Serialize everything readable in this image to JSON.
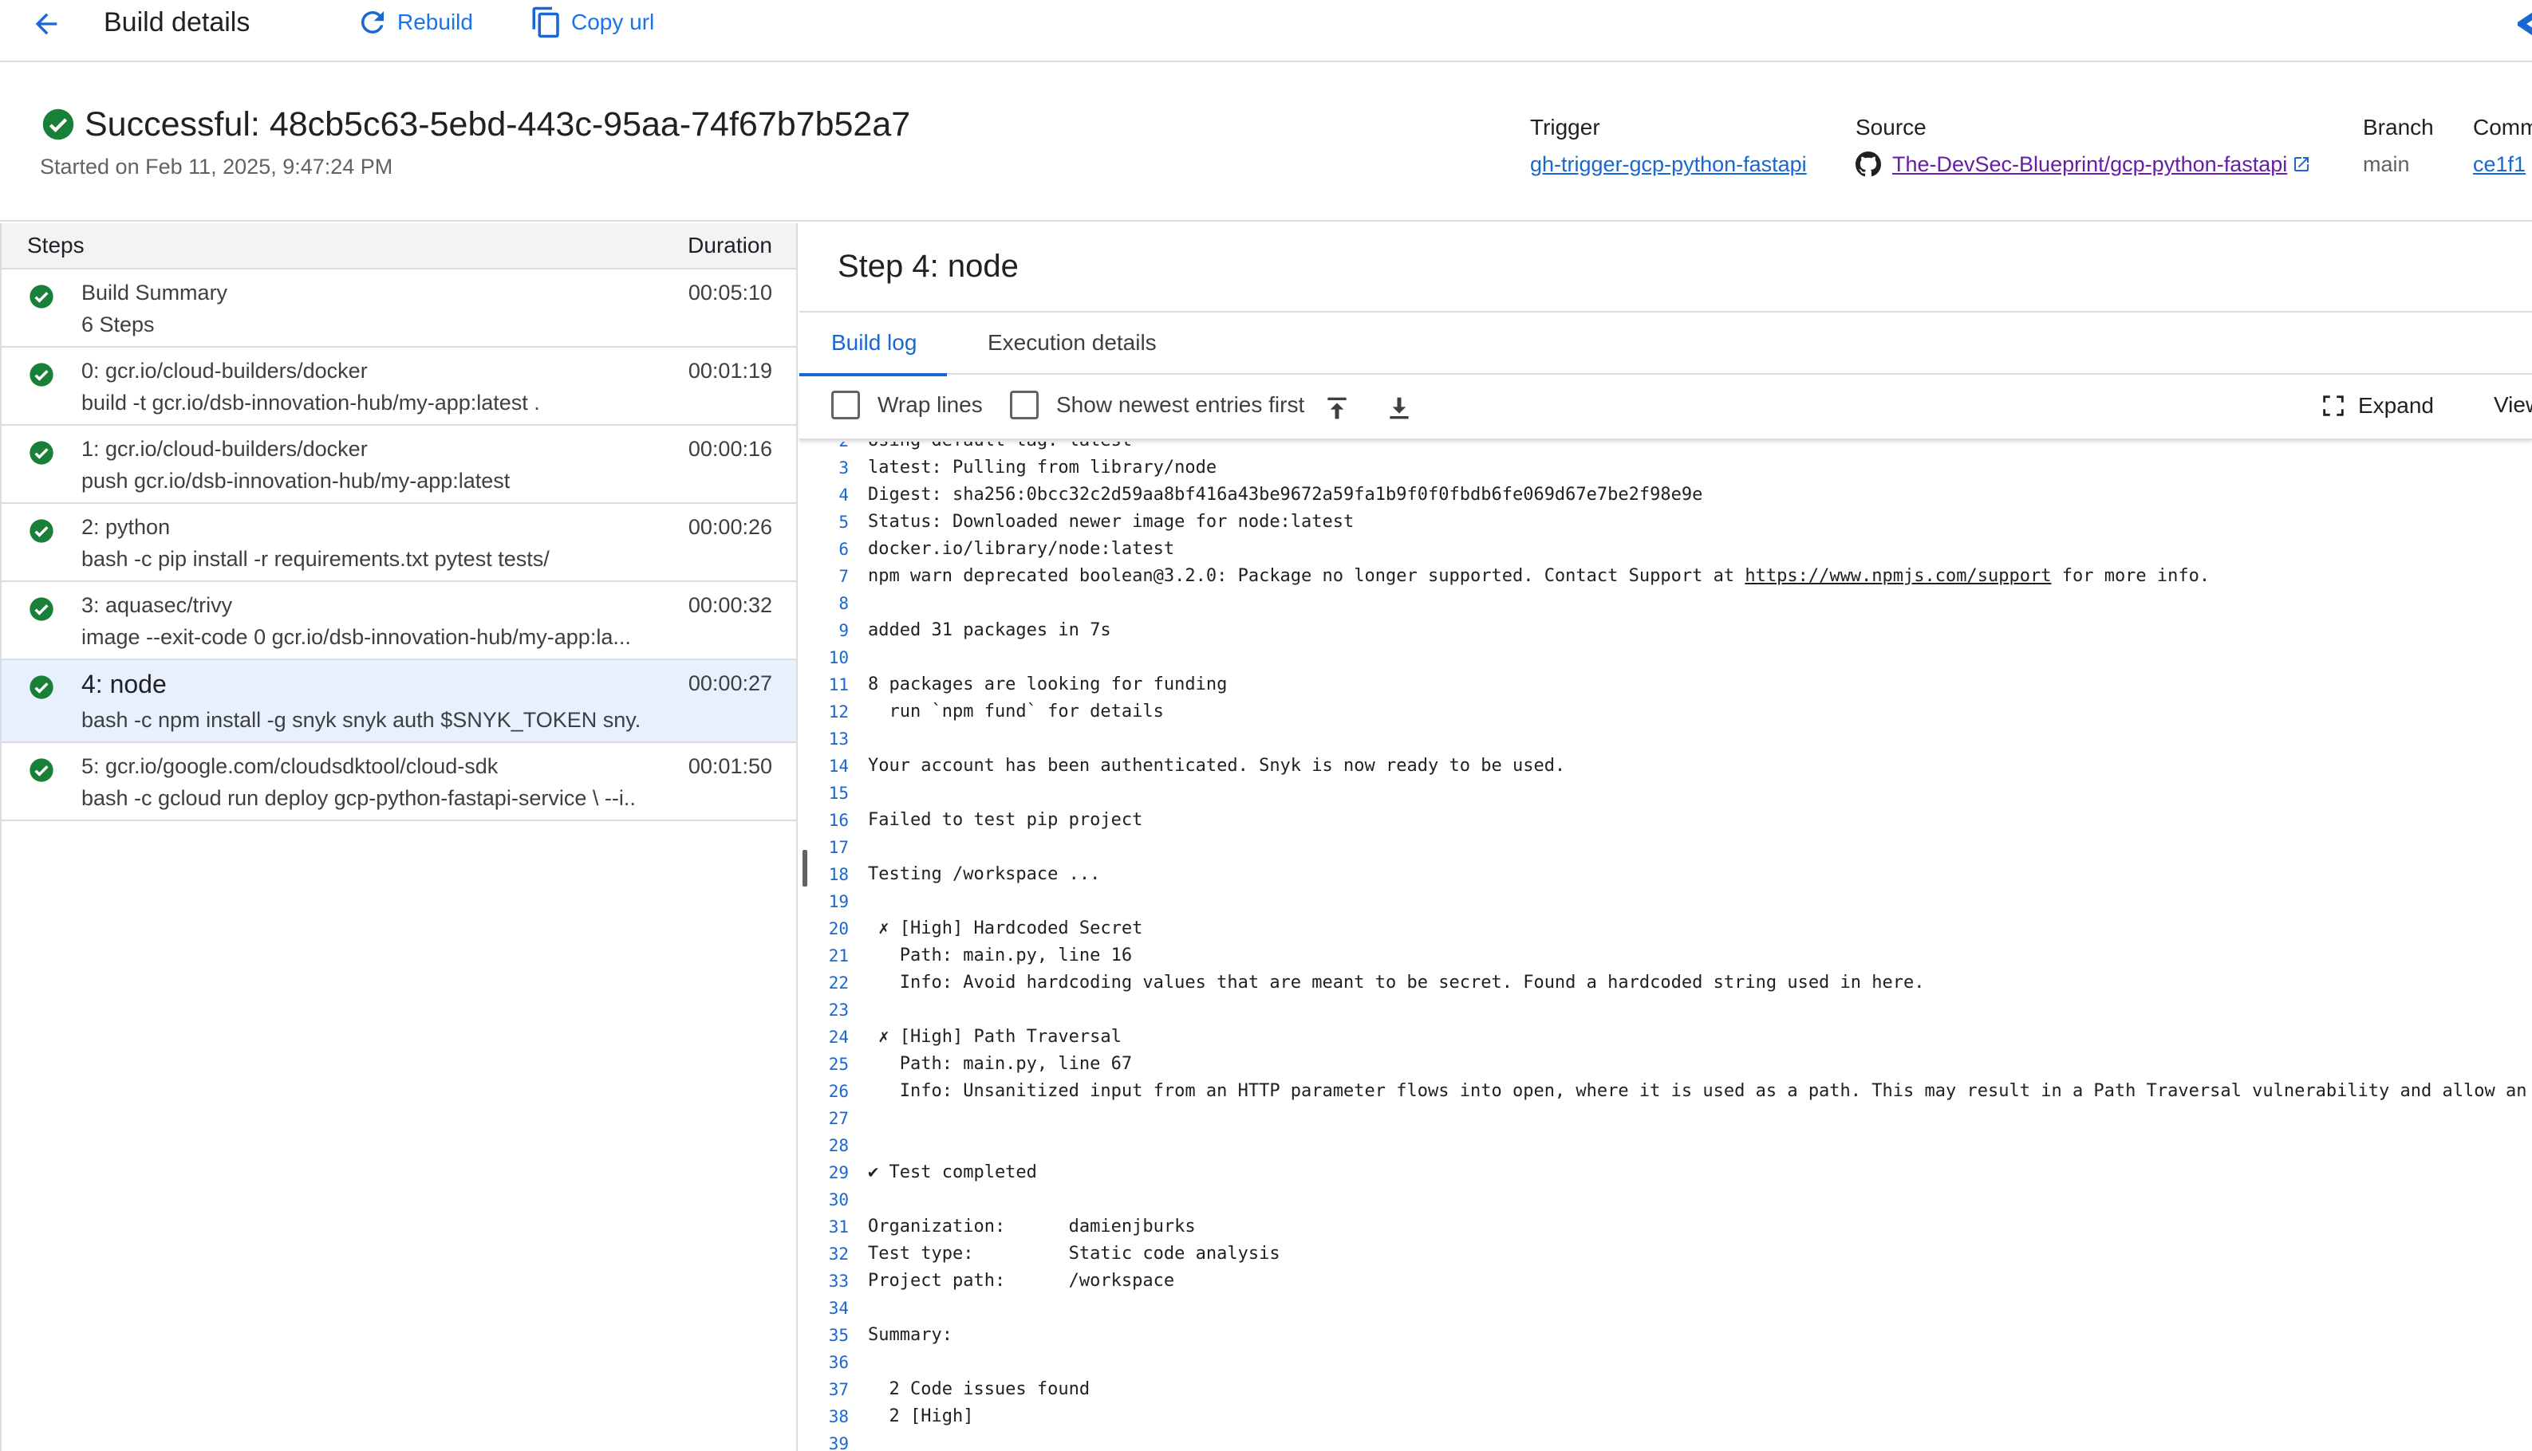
{
  "appbar": {
    "title": "Build details",
    "rebuild_label": "Rebuild",
    "copy_label": "Copy url"
  },
  "build": {
    "status_prefix": "Successful:",
    "id": "48cb5c63-5ebd-443c-95aa-74f67b7b52a7",
    "title": "Successful: 48cb5c63-5ebd-443c-95aa-74f67b7b52a7",
    "started": "Started on Feb 11, 2025, 9:47:24 PM",
    "trigger_label": "Trigger",
    "trigger_value": "gh-trigger-gcp-python-fastapi",
    "source_label": "Source",
    "source_value": "The-DevSec-Blueprint/gcp-python-fastapi",
    "branch_label": "Branch",
    "branch_value": "main",
    "commit_label": "Comm",
    "commit_value": "ce1f1",
    "status_color": "#188038"
  },
  "steps": {
    "header_steps": "Steps",
    "header_duration": "Duration",
    "items": [
      {
        "title": "Build Summary",
        "sub": "6 Steps",
        "duration": "00:05:10"
      },
      {
        "title": "0: gcr.io/cloud-builders/docker",
        "sub": "build -t gcr.io/dsb-innovation-hub/my-app:latest .",
        "duration": "00:01:19"
      },
      {
        "title": "1: gcr.io/cloud-builders/docker",
        "sub": "push gcr.io/dsb-innovation-hub/my-app:latest",
        "duration": "00:00:16"
      },
      {
        "title": "2: python",
        "sub": "bash -c pip install -r requirements.txt pytest tests/",
        "duration": "00:00:26"
      },
      {
        "title": "3: aquasec/trivy",
        "sub": "image --exit-code 0 gcr.io/dsb-innovation-hub/my-app:la...",
        "duration": "00:00:32"
      },
      {
        "title": "4: node",
        "sub": "bash -c npm install -g snyk snyk auth $SNYK_TOKEN sny.",
        "duration": "00:00:27"
      },
      {
        "title": "5: gcr.io/google.com/cloudsdktool/cloud-sdk",
        "sub": "bash -c gcloud run deploy gcp-python-fastapi-service \\ --i..",
        "duration": "00:01:50"
      }
    ]
  },
  "log": {
    "step_heading": "Step 4: node",
    "tab_build": "Build log",
    "tab_exec": "Execution details",
    "wrap_label": "Wrap lines",
    "newest_label": "Show newest entries first",
    "expand_label": "Expand",
    "view_label": "View",
    "lines": [
      {
        "n": "2",
        "t": "Using default tag: latest"
      },
      {
        "n": "3",
        "t": "latest: Pulling from library/node"
      },
      {
        "n": "4",
        "t": "Digest: sha256:0bcc32c2d59aa8bf416a43be9672a59fa1b9f0f0fbdb6fe069d67e7be2f98e9e"
      },
      {
        "n": "5",
        "t": "Status: Downloaded newer image for node:latest"
      },
      {
        "n": "6",
        "t": "docker.io/library/node:latest"
      },
      {
        "n": "7",
        "t": "npm warn deprecated boolean@3.2.0: Package no longer supported. Contact Support at ",
        "link": "https://www.npmjs.com/support",
        "after": " for more info."
      },
      {
        "n": "8",
        "t": ""
      },
      {
        "n": "9",
        "t": "added 31 packages in 7s"
      },
      {
        "n": "10",
        "t": ""
      },
      {
        "n": "11",
        "t": "8 packages are looking for funding"
      },
      {
        "n": "12",
        "t": "  run `npm fund` for details"
      },
      {
        "n": "13",
        "t": ""
      },
      {
        "n": "14",
        "t": "Your account has been authenticated. Snyk is now ready to be used."
      },
      {
        "n": "15",
        "t": ""
      },
      {
        "n": "16",
        "t": "Failed to test pip project"
      },
      {
        "n": "17",
        "t": ""
      },
      {
        "n": "18",
        "t": "Testing /workspace ..."
      },
      {
        "n": "19",
        "t": ""
      },
      {
        "n": "20",
        "t": " ✗ [High] Hardcoded Secret"
      },
      {
        "n": "21",
        "t": "   Path: main.py, line 16"
      },
      {
        "n": "22",
        "t": "   Info: Avoid hardcoding values that are meant to be secret. Found a hardcoded string used in here."
      },
      {
        "n": "23",
        "t": ""
      },
      {
        "n": "24",
        "t": " ✗ [High] Path Traversal"
      },
      {
        "n": "25",
        "t": "   Path: main.py, line 67"
      },
      {
        "n": "26",
        "t": "   Info: Unsanitized input from an HTTP parameter flows into open, where it is used as a path. This may result in a Path Traversal vulnerability and allow an"
      },
      {
        "n": "27",
        "t": ""
      },
      {
        "n": "28",
        "t": ""
      },
      {
        "n": "29",
        "t": "✔ Test completed"
      },
      {
        "n": "30",
        "t": ""
      },
      {
        "n": "31",
        "t": "Organization:      damienjburks"
      },
      {
        "n": "32",
        "t": "Test type:         Static code analysis"
      },
      {
        "n": "33",
        "t": "Project path:      /workspace"
      },
      {
        "n": "34",
        "t": ""
      },
      {
        "n": "35",
        "t": "Summary:"
      },
      {
        "n": "36",
        "t": ""
      },
      {
        "n": "37",
        "t": "  2 Code issues found"
      },
      {
        "n": "38",
        "t": "  2 [High]"
      },
      {
        "n": "39",
        "t": ""
      }
    ]
  },
  "colors": {
    "accent": "#1967d2",
    "success": "#188038",
    "selected_row": "#e8f0fe",
    "visited_link": "#681da8"
  }
}
